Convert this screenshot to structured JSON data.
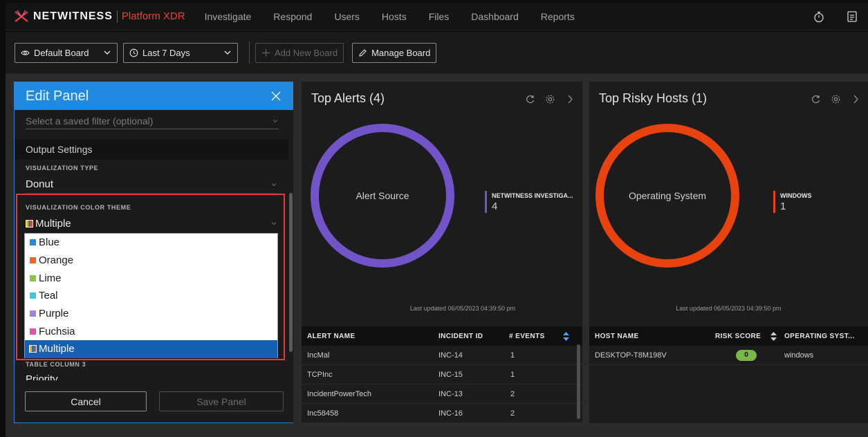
{
  "nav": {
    "brand": "NETWITNESS",
    "product": "Platform XDR",
    "items": [
      "Investigate",
      "Respond",
      "Users",
      "Hosts",
      "Files",
      "Dashboard",
      "Reports"
    ],
    "icons": [
      "stopwatch-icon",
      "notes-icon"
    ]
  },
  "toolbar": {
    "board": "Default Board",
    "range": "Last 7 Days",
    "add_board": "Add New Board",
    "manage_board": "Manage Board"
  },
  "edit_panel": {
    "title": "Edit Panel",
    "filter_placeholder": "Select a saved filter (optional)",
    "output_settings": "Output Settings",
    "viz_type_label": "VISUALIZATION TYPE",
    "viz_type_value": "Donut",
    "color_theme_label": "VISUALIZATION COLOR THEME",
    "color_theme_value": "Multiple",
    "options": [
      {
        "label": "Blue",
        "color": "#1f8ae0"
      },
      {
        "label": "Orange",
        "color": "#f26522"
      },
      {
        "label": "Lime",
        "color": "#8cc63f"
      },
      {
        "label": "Teal",
        "color": "#3cc8d6"
      },
      {
        "label": "Purple",
        "color": "#a67fe0"
      },
      {
        "label": "Fuchsia",
        "color": "#e84da8"
      },
      {
        "label": "Multiple",
        "color": "multi"
      }
    ],
    "table_column_3_label": "TABLE COLUMN 3",
    "table_column_3_value": "Priority",
    "cancel": "Cancel",
    "save": "Save Panel"
  },
  "top_alerts": {
    "title": "Top Alerts (4)",
    "center_label": "Alert Source",
    "legend_name": "NETWITNESS INVESTIGA...",
    "legend_value": "4",
    "color": "#7353c8",
    "updated": "Last updated 06/05/2023 04:39:50 pm",
    "columns": [
      "ALERT NAME",
      "INCIDENT ID",
      "# EVENTS"
    ],
    "rows": [
      [
        "IncMal",
        "INC-14",
        "1"
      ],
      [
        "TCPInc",
        "INC-15",
        "1"
      ],
      [
        "IncidentPowerTech",
        "INC-13",
        "2"
      ],
      [
        "Inc58458",
        "INC-16",
        "2"
      ]
    ]
  },
  "top_hosts": {
    "title": "Top Risky Hosts (1)",
    "center_label": "Operating System",
    "legend_name": "WINDOWS",
    "legend_value": "1",
    "color": "#e8420f",
    "updated": "Last updated 06/05/2023 04:39:50 pm",
    "columns": [
      "HOST NAME",
      "RISK SCORE",
      "OPERATING SYST..."
    ],
    "rows": [
      [
        "DESKTOP-T8M198V",
        "0",
        "windows"
      ]
    ]
  }
}
